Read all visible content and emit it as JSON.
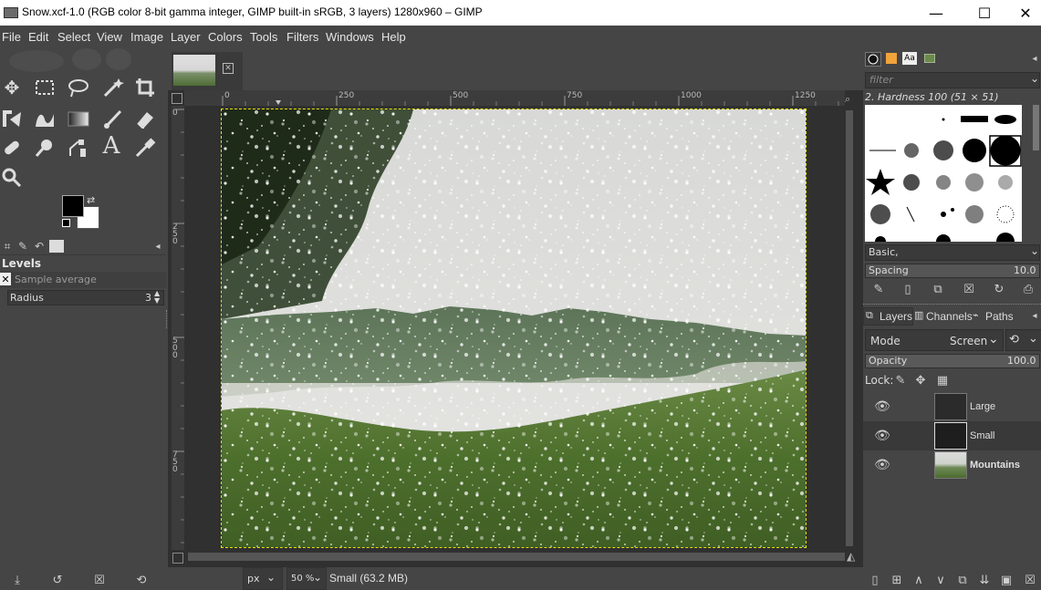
{
  "window": {
    "title": "Snow.xcf-1.0 (RGB color 8-bit gamma integer, GIMP built-in sRGB, 3 layers) 1280x960 – GIMP",
    "minimize": "—",
    "maximize": "☐",
    "close": "✕"
  },
  "menubar": {
    "items": [
      "File",
      "Edit",
      "Select",
      "View",
      "Image",
      "Layer",
      "Colors",
      "Tools",
      "Filters",
      "Windows",
      "Help"
    ]
  },
  "tool_options": {
    "title": "Levels",
    "sample_average_label": "Sample average",
    "radius_label": "Radius",
    "radius_value": "3"
  },
  "rulers": {
    "h_ticks": [
      "0",
      "250",
      "500",
      "750",
      "1000",
      "1250"
    ],
    "v_ticks": [
      "0",
      "250",
      "500",
      "750"
    ]
  },
  "statusbar": {
    "unit": "px",
    "zoom": "50 %",
    "layer_info": "Small (63.2 MB)"
  },
  "brushes": {
    "filter_placeholder": "filter",
    "current_brush": "2. Hardness 100 (51 × 51)",
    "tag": "Basic,",
    "spacing_label": "Spacing",
    "spacing_value": "10.0"
  },
  "layers_panel": {
    "tabs": [
      "Layers",
      "Channels",
      "Paths"
    ],
    "mode_label": "Mode",
    "mode_value": "Screen",
    "opacity_label": "Opacity",
    "opacity_value": "100.0",
    "lock_label": "Lock:",
    "layers": [
      {
        "name": "Large",
        "bold": false,
        "visible": true
      },
      {
        "name": "Small",
        "bold": false,
        "visible": true
      },
      {
        "name": "Mountains",
        "bold": true,
        "visible": true
      }
    ]
  },
  "colors": {
    "background": "#454545",
    "sky": "#dfe0dd",
    "selection": "#e6e600"
  }
}
